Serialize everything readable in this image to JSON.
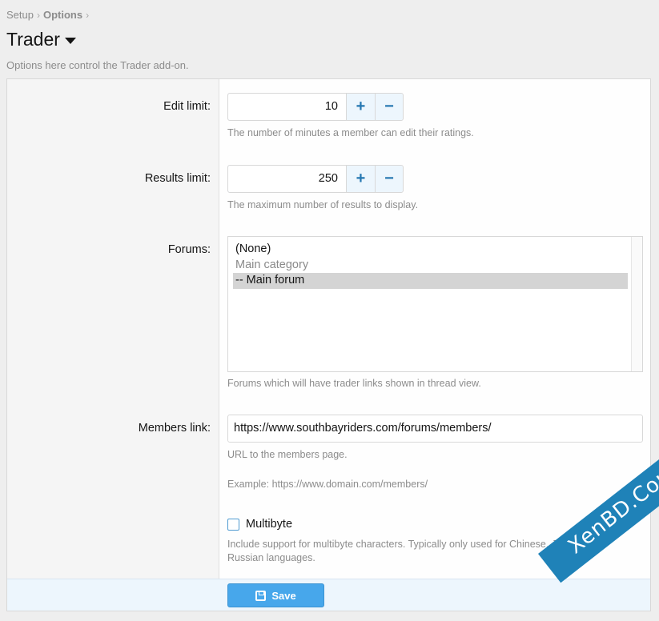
{
  "breadcrumb": {
    "items": [
      "Setup",
      "Options"
    ]
  },
  "page": {
    "title": "Trader",
    "description": "Options here control the Trader add-on."
  },
  "options": {
    "edit_limit": {
      "label": "Edit limit:",
      "value": "10",
      "hint": "The number of minutes a member can edit their ratings.",
      "plus": "+",
      "minus": "−"
    },
    "results_limit": {
      "label": "Results limit:",
      "value": "250",
      "hint": "The maximum number of results to display.",
      "plus": "+",
      "minus": "−"
    },
    "forums": {
      "label": "Forums:",
      "options": [
        "(None)",
        "Main category",
        "-- Main forum"
      ],
      "selected": "-- Main forum",
      "hint": "Forums which will have trader links shown in thread view."
    },
    "members_link": {
      "label": "Members link:",
      "value": "https://www.southbayriders.com/forums/members/",
      "hint": "URL to the members page.",
      "example": "Example: https://www.domain.com/members/"
    },
    "multibyte": {
      "label": "Multibyte",
      "checked": false,
      "hint": "Include support for multibyte characters. Typically only used for Chinese, Japanese, Russian languages."
    }
  },
  "footer": {
    "save_label": "Save"
  },
  "watermark": {
    "text": "XenBD.Com"
  },
  "colors": {
    "accent": "#47a7eb",
    "link": "#2577b1",
    "watermark": "#1f82b8"
  }
}
